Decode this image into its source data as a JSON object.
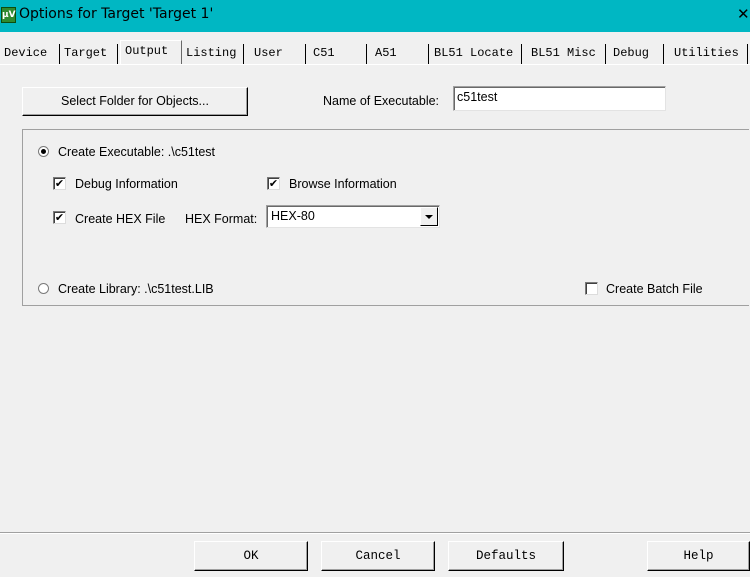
{
  "window": {
    "icon_text": "μV",
    "title": "Options for Target 'Target 1'",
    "close_glyph": "✕"
  },
  "tabs": [
    "Device",
    "Target",
    "Output",
    "Listing",
    "User",
    "C51",
    "A51",
    "BL51 Locate",
    "BL51 Misc",
    "Debug",
    "Utilities"
  ],
  "active_tab": "Output",
  "output": {
    "select_folder_label": "Select Folder for Objects...",
    "name_label": "Name of Executable:",
    "name_value": "c51test",
    "create_executable": {
      "label": "Create Executable:  .\\c51test",
      "selected": true
    },
    "debug_info": {
      "label": "Debug Information",
      "checked": true
    },
    "browse_info": {
      "label": "Browse Information",
      "checked": true
    },
    "create_hex": {
      "label": "Create HEX File",
      "checked": true
    },
    "hex_format_label": "HEX Format:",
    "hex_format_value": "HEX-80",
    "create_library": {
      "label": "Create Library:  .\\c51test.LIB",
      "selected": false
    },
    "create_batch": {
      "label": "Create Batch File",
      "checked": false
    }
  },
  "buttons": {
    "ok": "OK",
    "cancel": "Cancel",
    "defaults": "Defaults",
    "help": "Help"
  },
  "check_glyph": "✔"
}
